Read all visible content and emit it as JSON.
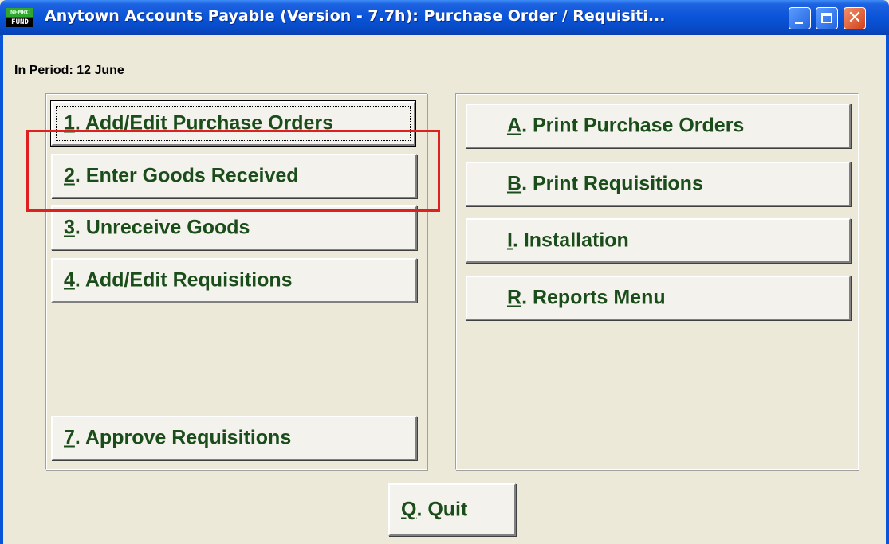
{
  "window": {
    "title": "Anytown Accounts Payable (Version - 7.7h):  Purchase Order / Requisiti...",
    "icon_top": "NEMRC",
    "icon_bottom": "FUND",
    "colors": {
      "titlebar": "#0a54d8",
      "background": "#ece9d8",
      "button_text": "#1b4d1b",
      "highlight": "#e02020"
    }
  },
  "header": {
    "period_label": "In Period: 12 June"
  },
  "left_buttons": [
    {
      "key": "1",
      "rest": ".  Add/Edit Purchase Orders"
    },
    {
      "key": "2",
      "rest": ". Enter Goods Received"
    },
    {
      "key": "3",
      "rest": ". Unreceive Goods"
    },
    {
      "key": "4",
      "rest": ". Add/Edit Requisitions"
    },
    {
      "key": "7",
      "rest": ". Approve Requisitions"
    }
  ],
  "right_buttons": [
    {
      "key": "A",
      "rest": ".  Print Purchase Orders"
    },
    {
      "key": "B",
      "rest": ". Print Requisitions"
    },
    {
      "key": "I",
      "rest": ".  Installation"
    },
    {
      "key": "R",
      "rest": ". Reports Menu"
    }
  ],
  "quit_button": {
    "key": "Q",
    "rest": ".  Quit"
  }
}
